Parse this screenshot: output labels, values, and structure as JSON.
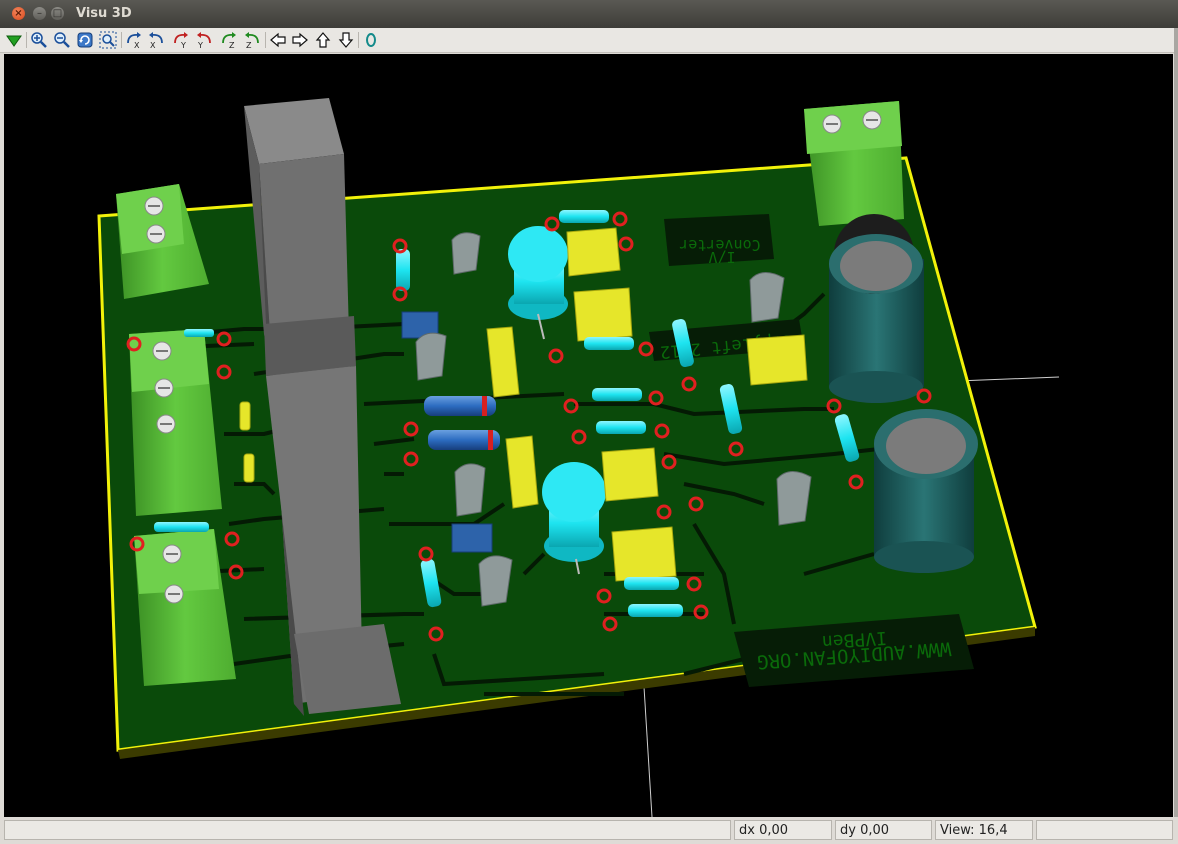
{
  "window": {
    "title": "Visu 3D"
  },
  "toolbar": {
    "buttons": [
      "reload-3d-icon",
      "zoom-in-icon",
      "zoom-out-icon",
      "redraw-icon",
      "zoom-fit-icon",
      "rotate-x-cw-icon",
      "rotate-x-ccw-icon",
      "rotate-y-cw-icon",
      "rotate-y-ccw-icon",
      "rotate-z-cw-icon",
      "rotate-z-ccw-icon",
      "pan-left-icon",
      "pan-right-icon",
      "pan-up-icon",
      "pan-down-icon",
      "ortho-icon"
    ]
  },
  "board": {
    "silkscreen_title_line1": "I/V",
    "silkscreen_title_line2": "Converter",
    "silkscreen_copyright": "Copyleft 2012",
    "silkscreen_author": "IVPBen",
    "silkscreen_url": "WWW.AUDIYOFAN.ORG",
    "colors": {
      "board": "#0a4a0a",
      "edge": "#f2f20a",
      "terminal": "#5cc23a",
      "heatsink": "#6d6d6d",
      "resistor": "#1ee4f0",
      "film_cap": "#e6e62a",
      "electrolytic": "#1c5e5e"
    }
  },
  "status": {
    "field1": "",
    "dx": "dx 0,00",
    "dy": "dy 0,00",
    "view": "View: 16,4",
    "field5": ""
  }
}
